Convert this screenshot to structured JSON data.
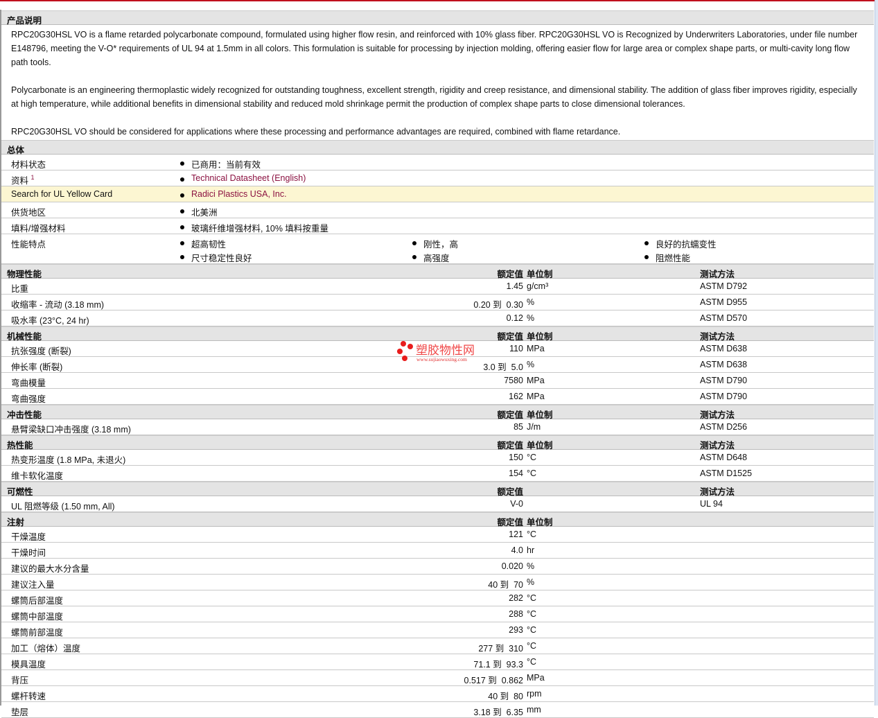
{
  "description": {
    "title": "产品说明",
    "paragraphs": [
      "RPC20G30HSL VO is a flame retarded polycarbonate compound, formulated using higher flow resin, and reinforced with 10% glass fiber. RPC20G30HSL VO is Recognized by Underwriters Laboratories, under file number E148796, meeting the V-O* requirements of UL 94 at 1.5mm in all colors. This formulation is suitable for processing by injection molding, offering easier flow for large area or complex shape parts, or multi-cavity long flow path tools.",
      "Polycarbonate is an engineering thermoplastic widely recognized for outstanding toughness, excellent strength, rigidity and creep resistance, and dimensional stability. The addition of glass fiber improves rigidity, especially at high temperature, while additional benefits in dimensional stability and reduced mold shrinkage permit the production of complex shape parts to close dimensional tolerances.",
      "RPC20G30HSL VO should be considered for applications where these processing and performance advantages are required, combined with flame retardance."
    ]
  },
  "general": {
    "title": "总体",
    "rows": [
      {
        "label": "材料状态",
        "value": "已商用：当前有效"
      },
      {
        "label": "资料",
        "sup": "1",
        "value": "Technical Datasheet (English)"
      },
      {
        "label": "Search for UL Yellow Card",
        "value": "Radici Plastics USA, Inc."
      },
      {
        "label": "供货地区",
        "value": "北美洲"
      },
      {
        "label": "填料/增强材料",
        "value": "玻璃纤维增强材料, 10% 填料按重量"
      }
    ],
    "features_label": "性能特点",
    "features": [
      "超高韧性",
      "尺寸稳定性良好",
      "刚性，高",
      "高强度",
      "良好的抗蠕变性",
      "阻燃性能"
    ]
  },
  "columns": {
    "value": "额定值",
    "unit": "单位制",
    "test": "测试方法"
  },
  "sections": [
    {
      "title": "物理性能",
      "unit": true,
      "test": true,
      "rows": [
        {
          "name": "比重",
          "value": "1.45",
          "unit": "g/cm³",
          "test": "ASTM D792"
        },
        {
          "name": "收缩率 - 流动 (3.18 mm)",
          "value": "0.20 到  0.30",
          "unit": "%",
          "test": "ASTM D955"
        },
        {
          "name": "吸水率 (23°C, 24 hr)",
          "value": "0.12",
          "unit": "%",
          "test": "ASTM D570"
        }
      ]
    },
    {
      "title": "机械性能",
      "unit": true,
      "test": true,
      "rows": [
        {
          "name": "抗张强度 (断裂)",
          "value": "110",
          "unit": "MPa",
          "test": "ASTM D638"
        },
        {
          "name": "伸长率 (断裂)",
          "value": "3.0 到  5.0",
          "unit": "%",
          "test": "ASTM D638"
        },
        {
          "name": "弯曲模量",
          "value": "7580",
          "unit": "MPa",
          "test": "ASTM D790"
        },
        {
          "name": "弯曲强度",
          "value": "162",
          "unit": "MPa",
          "test": "ASTM D790"
        }
      ]
    },
    {
      "title": "冲击性能",
      "unit": true,
      "test": true,
      "rows": [
        {
          "name": "悬臂梁缺口冲击强度 (3.18 mm)",
          "value": "85",
          "unit": "J/m",
          "test": "ASTM D256"
        }
      ]
    },
    {
      "title": "热性能",
      "unit": true,
      "test": true,
      "rows": [
        {
          "name": "热变形温度 (1.8 MPa, 未退火)",
          "value": "150",
          "unit": "°C",
          "test": "ASTM D648"
        },
        {
          "name": "维卡软化温度",
          "value": "154",
          "unit": "°C",
          "test": "ASTM D1525"
        }
      ]
    },
    {
      "title": "可燃性",
      "unit": false,
      "test": true,
      "rows": [
        {
          "name": "UL 阻燃等级 (1.50 mm, All)",
          "value": "V-0",
          "unit": "",
          "test": "UL 94"
        }
      ]
    },
    {
      "title": "注射",
      "unit": true,
      "test": false,
      "rows": [
        {
          "name": "干燥温度",
          "value": "121",
          "unit": "°C",
          "test": ""
        },
        {
          "name": "干燥时间",
          "value": "4.0",
          "unit": "hr",
          "test": ""
        },
        {
          "name": "建议的最大水分含量",
          "value": "0.020",
          "unit": "%",
          "test": ""
        },
        {
          "name": "建议注入量",
          "value": "40 到  70",
          "unit": "%",
          "test": ""
        },
        {
          "name": "螺筒后部温度",
          "value": "282",
          "unit": "°C",
          "test": ""
        },
        {
          "name": "螺筒中部温度",
          "value": "288",
          "unit": "°C",
          "test": ""
        },
        {
          "name": "螺筒前部温度",
          "value": "293",
          "unit": "°C",
          "test": ""
        },
        {
          "name": "加工（熔体）温度",
          "value": "277 到  310",
          "unit": "°C",
          "test": ""
        },
        {
          "name": "模具温度",
          "value": "71.1 到  93.3",
          "unit": "°C",
          "test": ""
        },
        {
          "name": "背压",
          "value": "0.517 到  0.862",
          "unit": "MPa",
          "test": ""
        },
        {
          "name": "螺杆转速",
          "value": "40 到  80",
          "unit": "rpm",
          "test": ""
        },
        {
          "name": "垫层",
          "value": "3.18 到  6.35",
          "unit": "mm",
          "test": ""
        }
      ]
    }
  ],
  "watermark": {
    "title": "塑胶物性网",
    "url": "www.sujiaowuxing.com"
  }
}
